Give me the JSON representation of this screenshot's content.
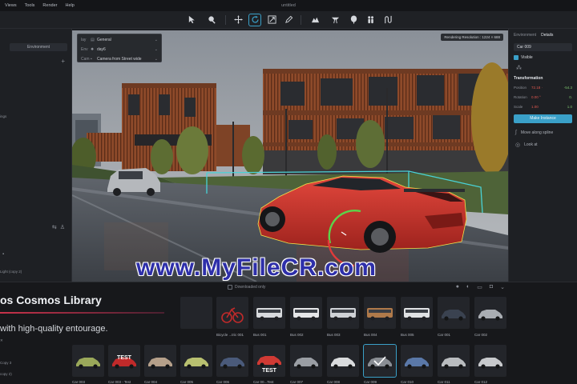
{
  "menubar": {
    "items": [
      "Views",
      "Tools",
      "Render",
      "Help"
    ],
    "title": "untitled"
  },
  "toolbar": {
    "tools": [
      "select-arrow-icon",
      "paint-icon",
      "move-icon",
      "rotate-icon",
      "scale-icon",
      "pen-icon",
      "terrain-icon",
      "road-icon",
      "tree-icon",
      "people-icon",
      "path-icon"
    ],
    "active_tool": "rotate-icon",
    "accent": "#3aa0c8"
  },
  "left_panel": {
    "tab": "Environment",
    "items": [
      "ings",
      "Light (copy 2)",
      "Copy 3",
      "copy 2)"
    ]
  },
  "viewport": {
    "rows": [
      {
        "key": "lay",
        "value": "General"
      },
      {
        "key": "Env",
        "value": "day6"
      },
      {
        "key": "Cam",
        "value": "Camera from Street wide"
      }
    ],
    "render_resolution": "Rendering Resolution : 1224 × 688"
  },
  "right_panel": {
    "tabs": [
      "Environment",
      "Details"
    ],
    "active_tab": "Details",
    "object_name": "Car 009",
    "visible_label": "Visible",
    "section": "Transformation",
    "props": [
      {
        "label": "Position",
        "a": "72.18 ·",
        "b": "-54.3"
      },
      {
        "label": "Rotation",
        "a": "0.00 °",
        "b": "0."
      },
      {
        "label": "Scale",
        "a": "1.00",
        "b": "1.0"
      }
    ],
    "make_instance": "Make Instance",
    "move_spline": "Move along spline",
    "look_at": "Look at"
  },
  "library": {
    "title": "os Cosmos Library",
    "subtitle": "with high-quality entourage.",
    "downloaded_only": "Downloaded only",
    "row1": [
      {
        "label": ""
      },
      {
        "label": "Bicycle ...tric 001"
      },
      {
        "label": "Bus 001"
      },
      {
        "label": "Bus 002"
      },
      {
        "label": "Bus 003"
      },
      {
        "label": "Bus 004"
      },
      {
        "label": "Bus 005"
      },
      {
        "label": "Car 001"
      },
      {
        "label": "Car 002"
      }
    ],
    "row2": [
      {
        "label": "Car 003",
        "tag": ""
      },
      {
        "label": "Car 003 - Test",
        "tag": "TEST"
      },
      {
        "label": "Car 004",
        "tag": ""
      },
      {
        "label": "Car 005",
        "tag": ""
      },
      {
        "label": "Car 006",
        "tag": ""
      },
      {
        "label": "Car 00...Test",
        "tag": "TEST"
      },
      {
        "label": "Car 007",
        "tag": ""
      },
      {
        "label": "Car 008",
        "tag": ""
      },
      {
        "label": "Car 009",
        "tag": ""
      },
      {
        "label": "Car 010",
        "tag": ""
      },
      {
        "label": "Car 011",
        "tag": ""
      },
      {
        "label": "Car 012",
        "tag": ""
      }
    ]
  },
  "watermark": "www.MyFileCR.com"
}
